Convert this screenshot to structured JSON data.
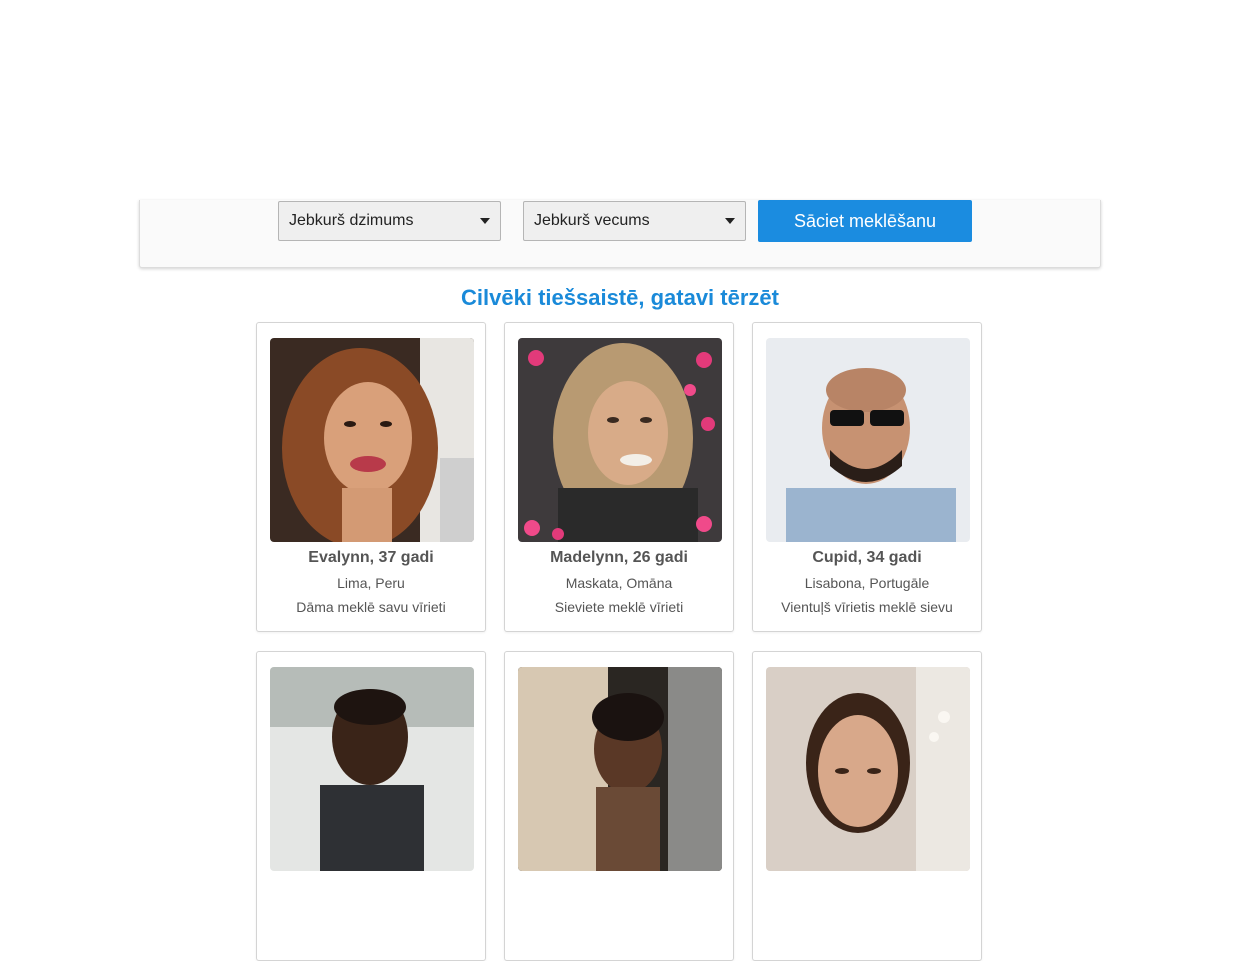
{
  "search": {
    "gender_value": "Jebkurš dzimums",
    "age_value": "Jebkurš vecums",
    "button_label": "Sāciet meklēšanu"
  },
  "heading": "Cilvēki tiešsaistē, gatavi tērzēt",
  "profiles": [
    {
      "name": "Evalynn, 37 gadi",
      "location": "Lima, Peru",
      "seeking": "Dāma meklē savu vīrieti"
    },
    {
      "name": "Madelynn, 26 gadi",
      "location": "Maskata, Omāna",
      "seeking": "Sieviete meklē vīrieti"
    },
    {
      "name": "Cupid, 34 gadi",
      "location": "Lisabona, Portugāle",
      "seeking": "Vientuļš vīrietis meklē sievu"
    },
    {
      "name": "",
      "location": "",
      "seeking": ""
    },
    {
      "name": "",
      "location": "",
      "seeking": ""
    },
    {
      "name": "",
      "location": "",
      "seeking": ""
    }
  ],
  "colors": {
    "accent": "#1b8ce0",
    "heading": "#1a8ad9",
    "text": "#555555"
  },
  "icons": {
    "dropdown": "chevron-down-icon"
  }
}
